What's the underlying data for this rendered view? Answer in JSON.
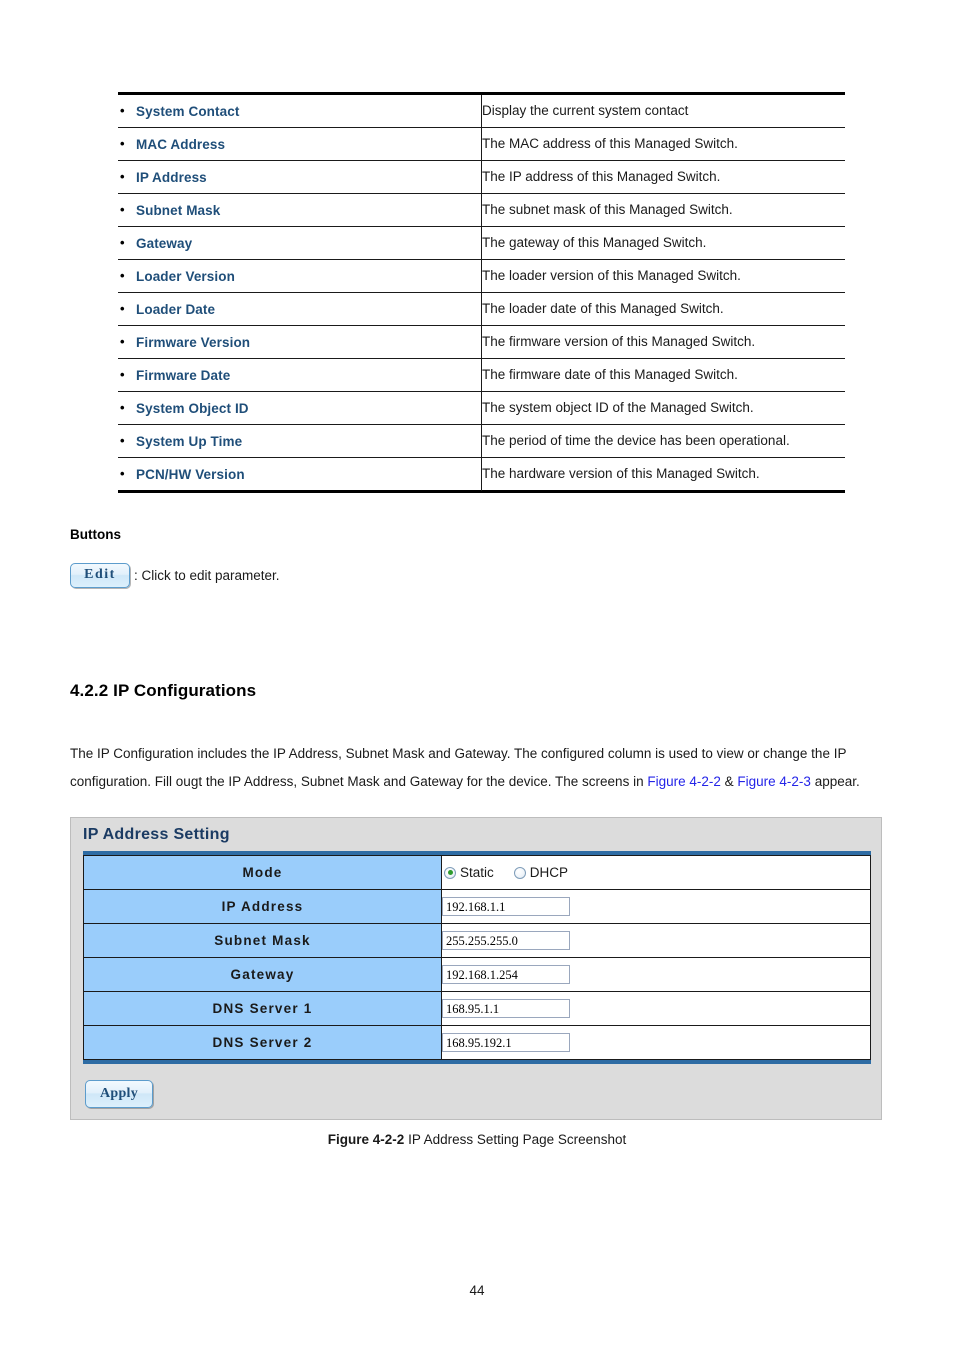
{
  "desc_table": {
    "rows": [
      {
        "term": "System Contact",
        "definition": "Display the current system contact"
      },
      {
        "term": "MAC Address",
        "definition": "The MAC address of this Managed Switch."
      },
      {
        "term": "IP Address",
        "definition": "The IP address of this Managed Switch."
      },
      {
        "term": "Subnet Mask",
        "definition": "The subnet mask of this Managed Switch."
      },
      {
        "term": "Gateway",
        "definition": "The gateway of this Managed Switch."
      },
      {
        "term": "Loader Version",
        "definition": "The loader version of this Managed Switch."
      },
      {
        "term": "Loader Date",
        "definition": "The loader date of this Managed Switch."
      },
      {
        "term": "Firmware Version",
        "definition": "The firmware version of this Managed Switch."
      },
      {
        "term": "Firmware Date",
        "definition": "The firmware date of this Managed Switch."
      },
      {
        "term": "System Object ID",
        "definition": "The system object ID of the Managed Switch."
      },
      {
        "term": "System Up Time",
        "definition": "The period of time the device has been operational."
      },
      {
        "term": "PCN/HW Version",
        "definition": "The hardware version of this Managed Switch."
      }
    ]
  },
  "buttons_section": {
    "heading": "Buttons",
    "edit_label": "Edit",
    "edit_description": ": Click to edit parameter."
  },
  "section": {
    "heading": "4.2.2 IP Configurations",
    "paragraph_part1": "The IP Configuration includes the IP Address, Subnet Mask and Gateway. The configured column is used to view or change the IP configuration. Fill ougt the IP Address, Subnet Mask and Gateway for the device. The screens in ",
    "link1": "Figure 4-2-2",
    "paragraph_mid": " & ",
    "link2": "Figure 4-2-3",
    "paragraph_part2": " appear."
  },
  "ip_panel": {
    "title": "IP Address Setting",
    "mode": {
      "label": "Mode",
      "options": [
        {
          "label": "Static",
          "checked": true
        },
        {
          "label": "DHCP",
          "checked": false
        }
      ]
    },
    "fields": [
      {
        "label": "IP Address",
        "value": "192.168.1.1"
      },
      {
        "label": "Subnet Mask",
        "value": "255.255.255.0"
      },
      {
        "label": "Gateway",
        "value": "192.168.1.254"
      },
      {
        "label": "DNS Server 1",
        "value": "168.95.1.1"
      },
      {
        "label": "DNS Server 2",
        "value": "168.95.192.1"
      }
    ],
    "apply_label": "Apply"
  },
  "figure_caption": {
    "bold": "Figure 4-2-2",
    "rest": " IP Address Setting Page Screenshot"
  },
  "page_number": "44",
  "colors": {
    "term_blue": "#1F4E79",
    "link_blue": "#2424e8",
    "panel_bg": "#dcdcdc",
    "label_cell_blue": "#9ACDFB",
    "table_frame_blue": "#2E6CA4",
    "radio_dot_green": "#2e9b2e"
  }
}
